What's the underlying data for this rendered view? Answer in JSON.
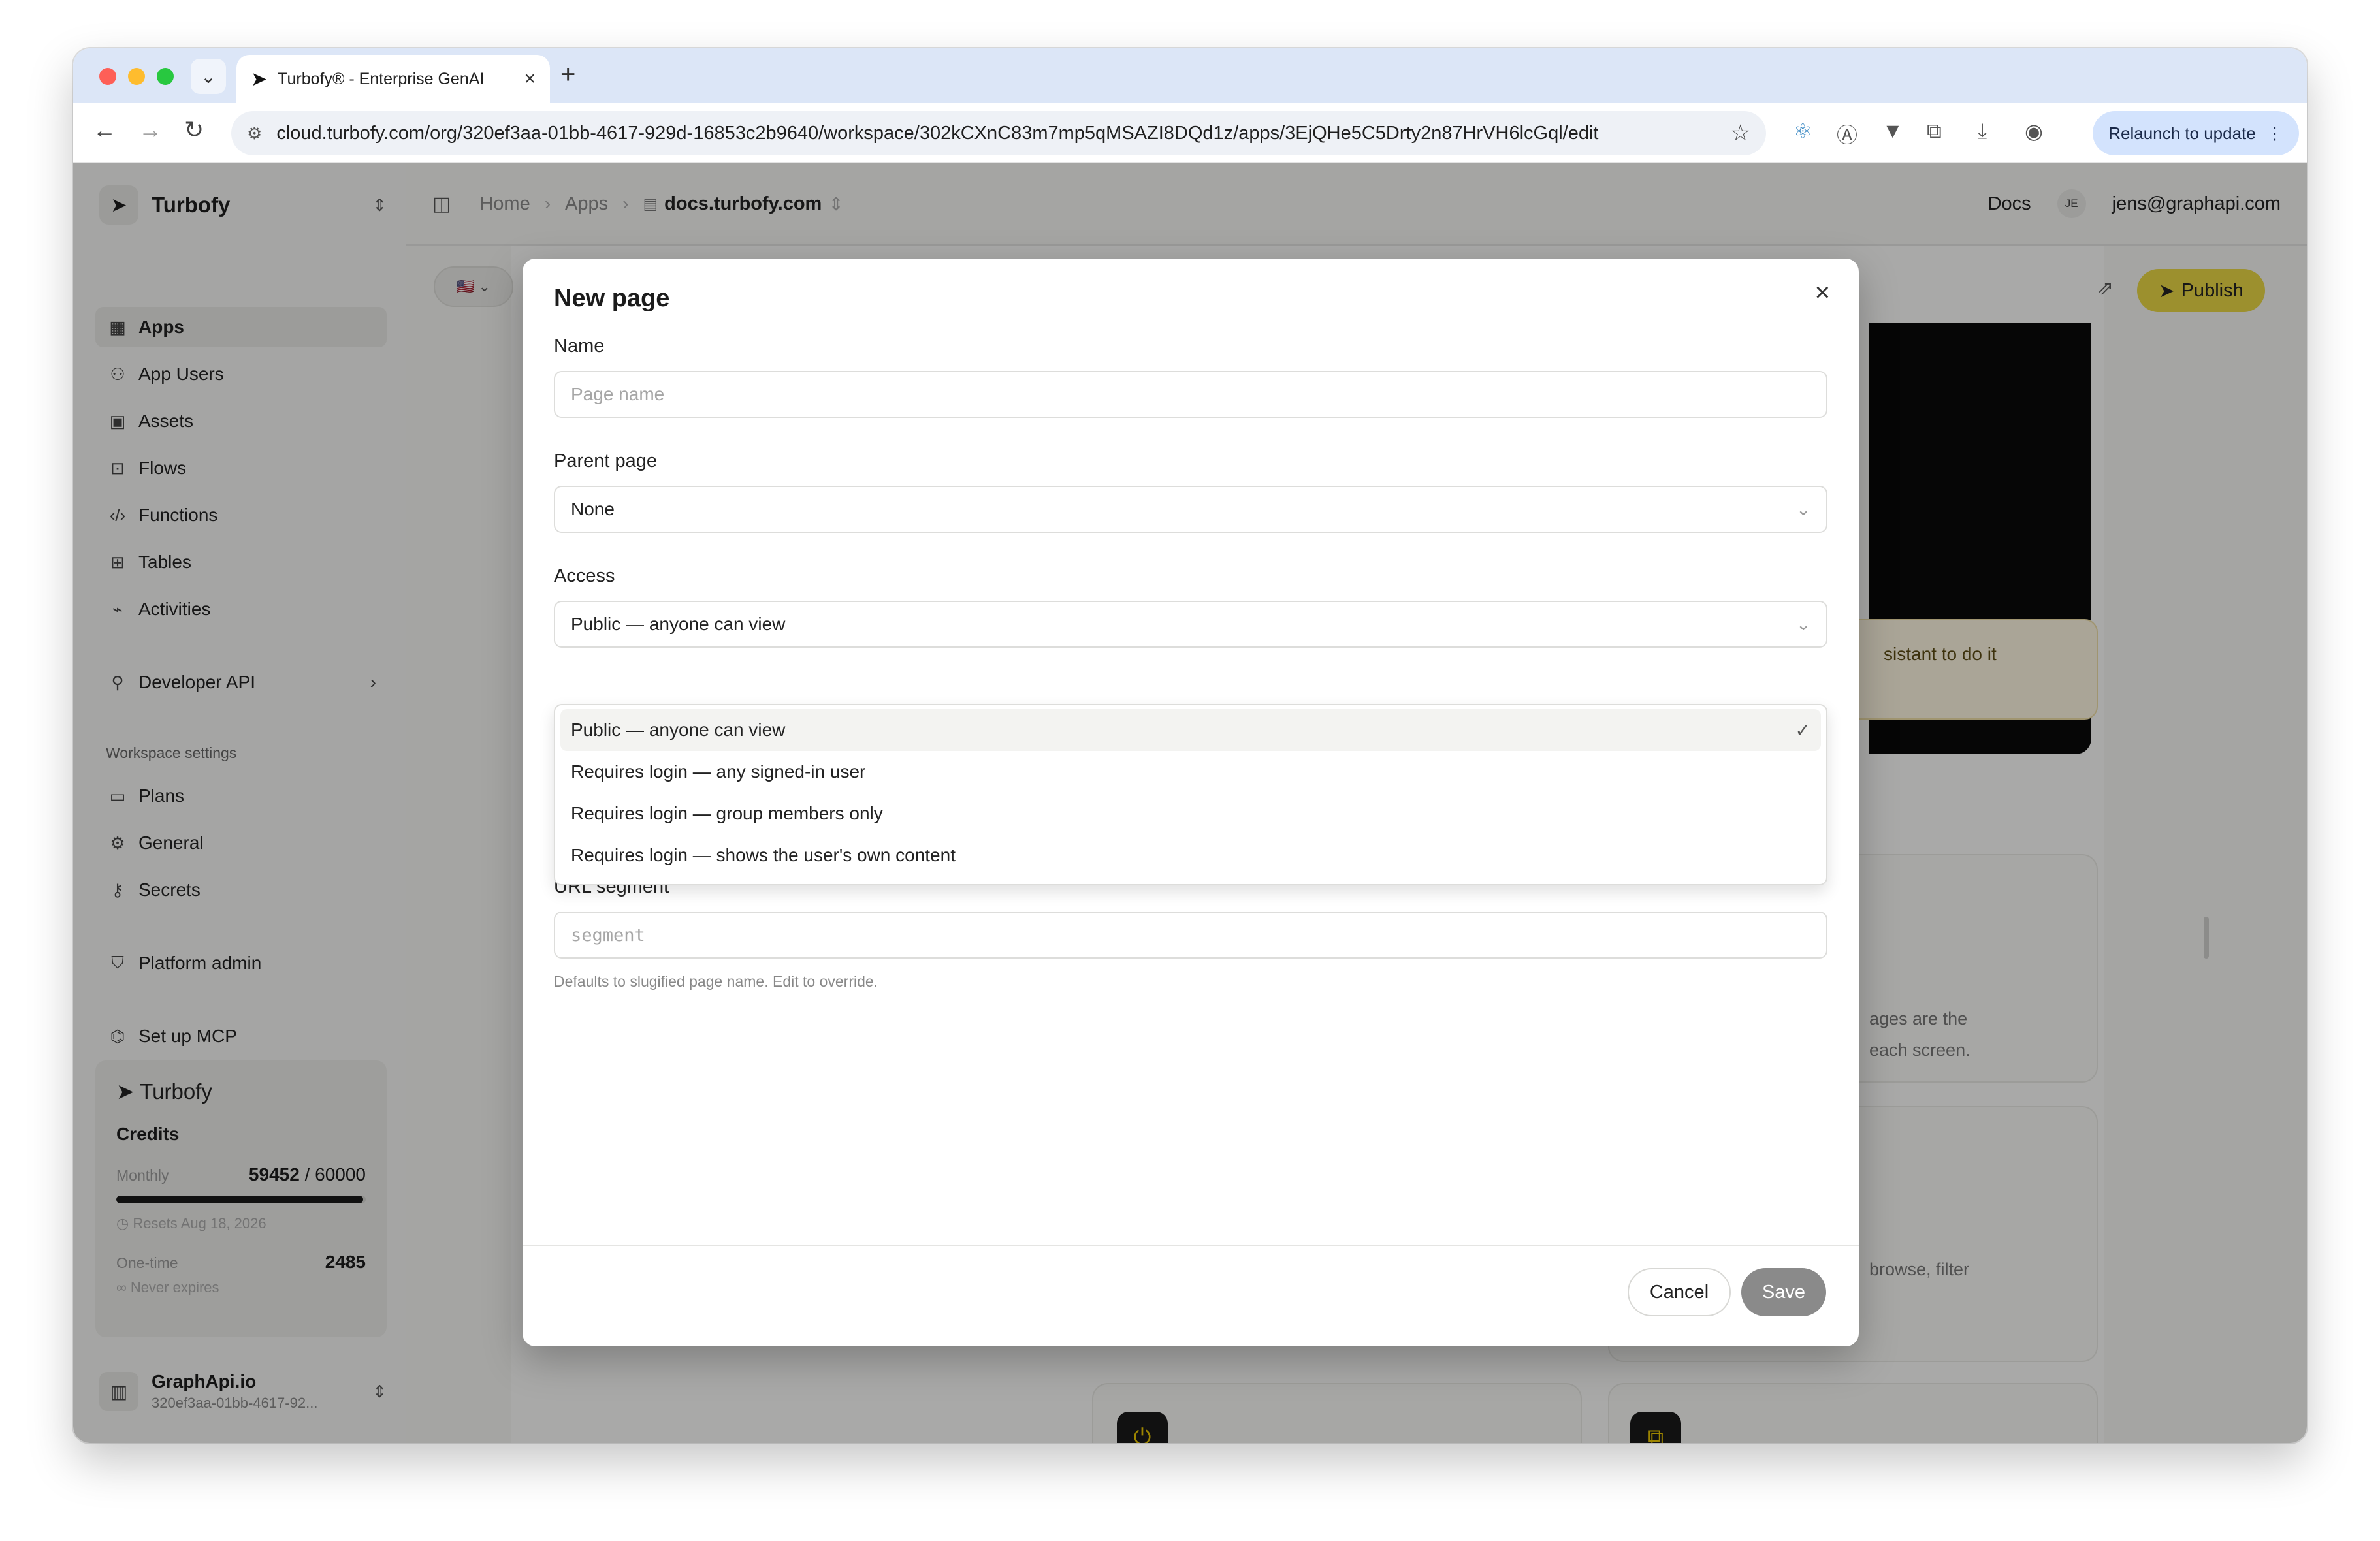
{
  "browser": {
    "tab_title": "Turbofy® - Enterprise GenAI",
    "url": "cloud.turbofy.com/org/320ef3aa-01bb-4617-929d-16853c2b9640/workspace/302kCXnC83m7mp5qMSAZI8DQd1z/apps/3EjQHe5C5Drty2n87HrVH6lcGql/edit",
    "relaunch_label": "Relaunch to update"
  },
  "sidebar": {
    "org_name": "Turbofy",
    "items": [
      {
        "label": "Apps",
        "icon": "apps-grid-icon"
      },
      {
        "label": "App Users",
        "icon": "users-icon"
      },
      {
        "label": "Assets",
        "icon": "image-icon"
      },
      {
        "label": "Flows",
        "icon": "robot-icon"
      },
      {
        "label": "Functions",
        "icon": "code-icon"
      },
      {
        "label": "Tables",
        "icon": "table-icon"
      },
      {
        "label": "Activities",
        "icon": "activity-icon"
      }
    ],
    "developer_api": "Developer API",
    "workspace_settings_label": "Workspace settings",
    "settings_items": [
      {
        "label": "Plans"
      },
      {
        "label": "General"
      },
      {
        "label": "Secrets"
      }
    ],
    "platform_admin": "Platform admin",
    "setup_mcp": "Set up MCP",
    "credits": {
      "brand": "Turbofy",
      "title": "Credits",
      "monthly_label": "Monthly",
      "monthly_used": "59452",
      "monthly_total": "/ 60000",
      "monthly_progress": 0.99,
      "resets": "Resets Aug 18, 2026",
      "onetime_label": "One-time",
      "onetime_value": "2485",
      "never_expires": "Never expires"
    },
    "workspace": {
      "name": "GraphApi.io",
      "id": "320ef3aa-01bb-4617-92..."
    }
  },
  "topbar": {
    "breadcrumb": [
      "Home",
      "Apps"
    ],
    "current": "docs.turbofy.com",
    "docs": "Docs",
    "avatar_initials": "JE",
    "user_email": "jens@graphapi.com"
  },
  "editor": {
    "publish_label": "Publish",
    "background_note": "sistant to do it",
    "bg_text_1": "ages are the",
    "bg_text_2": "each screen.",
    "bg_text_3": "browse, filter"
  },
  "modal": {
    "title": "New page",
    "name_label": "Name",
    "name_placeholder": "Page name",
    "parent_label": "Parent page",
    "parent_value": "None",
    "access_label": "Access",
    "access_value": "Public — anyone can view",
    "access_options": [
      "Public — anyone can view",
      "Requires login — any signed-in user",
      "Requires login — group members only",
      "Requires login — shows the user's own content"
    ],
    "url_label": "URL segment",
    "url_placeholder": "segment",
    "url_helper": "Defaults to slugified page name. Edit to override.",
    "cancel": "Cancel",
    "save": "Save"
  }
}
